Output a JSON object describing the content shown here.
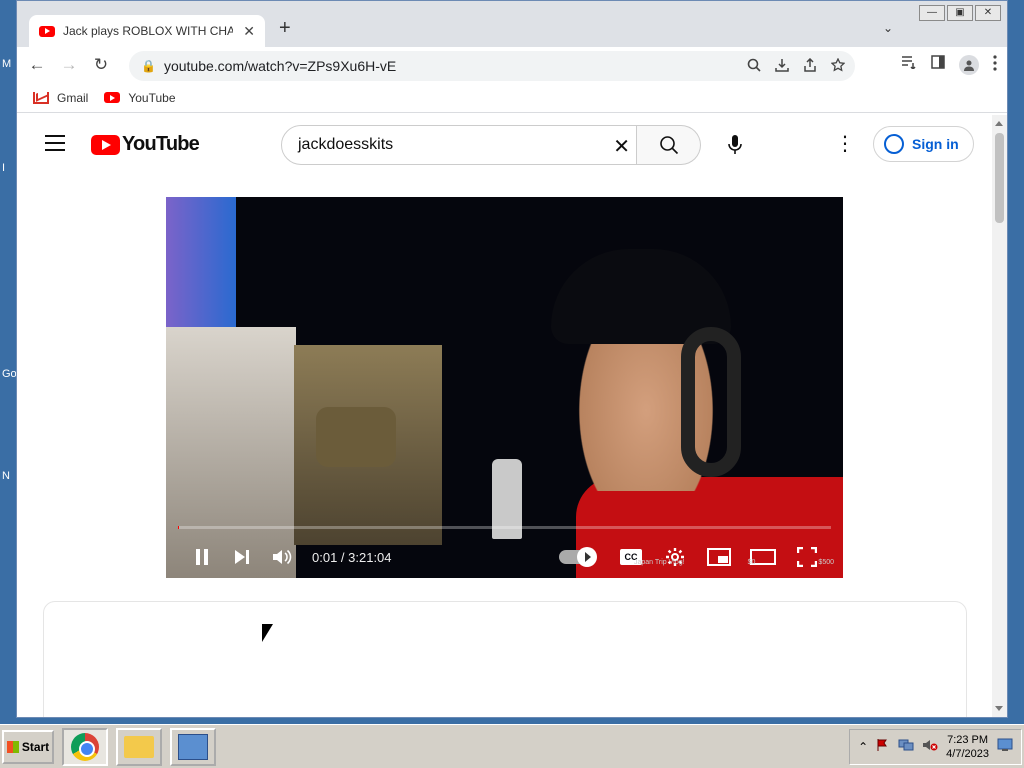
{
  "desktop": {
    "fragments": [
      "M",
      "I",
      "Go",
      "N"
    ]
  },
  "browser": {
    "tab": {
      "title": "Jack plays ROBLOX WITH CHAT!",
      "close_glyph": "✕"
    },
    "new_tab_glyph": "+",
    "tab_search_glyph": "⌄",
    "window_controls": {
      "minimize": "—",
      "restore": "▣",
      "close": "✕"
    },
    "nav": {
      "back": "←",
      "forward": "→",
      "reload": "↻"
    },
    "omnibox": {
      "lock": "🔒",
      "url": "youtube.com/watch?v=ZPs9Xu6H-vE"
    },
    "bookmarks": [
      {
        "label": "Gmail"
      },
      {
        "label": "YouTube"
      }
    ]
  },
  "youtube": {
    "wordmark": "YouTube",
    "search": {
      "value": "jackdoesskits",
      "clear_glyph": "✕"
    },
    "more_glyph": "⋮",
    "signin_label": "Sign in",
    "player": {
      "time": "0:01 / 3:21:04",
      "progress": 0.0001,
      "watermark": {
        "left": "Japan Trip Vlog!",
        "mid": "$0",
        "right": "$500"
      }
    }
  },
  "taskbar": {
    "start_label": "Start",
    "tray": {
      "time": "7:23 PM",
      "date": "4/7/2023",
      "expand_glyph": "⌃"
    }
  }
}
